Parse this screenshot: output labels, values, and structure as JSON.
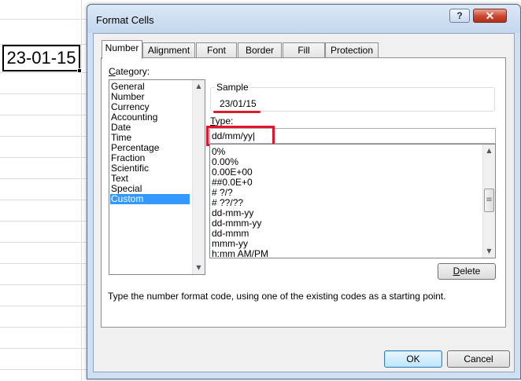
{
  "spreadsheet": {
    "active_cell_value": "23-01-15"
  },
  "dialog": {
    "title": "Format Cells",
    "help_label": "?",
    "close_label": "✕",
    "tabs": [
      {
        "label": "Number",
        "active": true
      },
      {
        "label": "Alignment",
        "active": false
      },
      {
        "label": "Font",
        "active": false
      },
      {
        "label": "Border",
        "active": false
      },
      {
        "label": "Fill",
        "active": false
      },
      {
        "label": "Protection",
        "active": false
      }
    ],
    "category": {
      "label_prefix": "",
      "label_ul": "C",
      "label_rest": "ategory:",
      "items": [
        "General",
        "Number",
        "Currency",
        "Accounting",
        "Date",
        "Time",
        "Percentage",
        "Fraction",
        "Scientific",
        "Text",
        "Special",
        "Custom"
      ],
      "selected": "Custom"
    },
    "sample": {
      "label": "Sample",
      "value": "23/01/15"
    },
    "type": {
      "label_ul": "T",
      "label_rest": "ype:",
      "value": "dd/mm/yy|"
    },
    "format_codes": [
      "0%",
      "0.00%",
      "0.00E+00",
      "##0.0E+0",
      "# ?/?",
      "# ??/??",
      "dd-mm-yy",
      "dd-mmm-yy",
      "dd-mmm",
      "mmm-yy",
      "h:mm AM/PM"
    ],
    "delete_label_ul": "D",
    "delete_label_rest": "elete",
    "help_text": "Type the number format code, using one of the existing codes as a starting point.",
    "ok_label": "OK",
    "cancel_label": "Cancel",
    "accent_colors": {
      "highlight": "#e0142b",
      "selection": "#3399ff"
    },
    "icons": {
      "scroll_up": "up-arrow-icon",
      "scroll_down": "down-arrow-icon",
      "scroll_grip": "grip-icon"
    }
  }
}
